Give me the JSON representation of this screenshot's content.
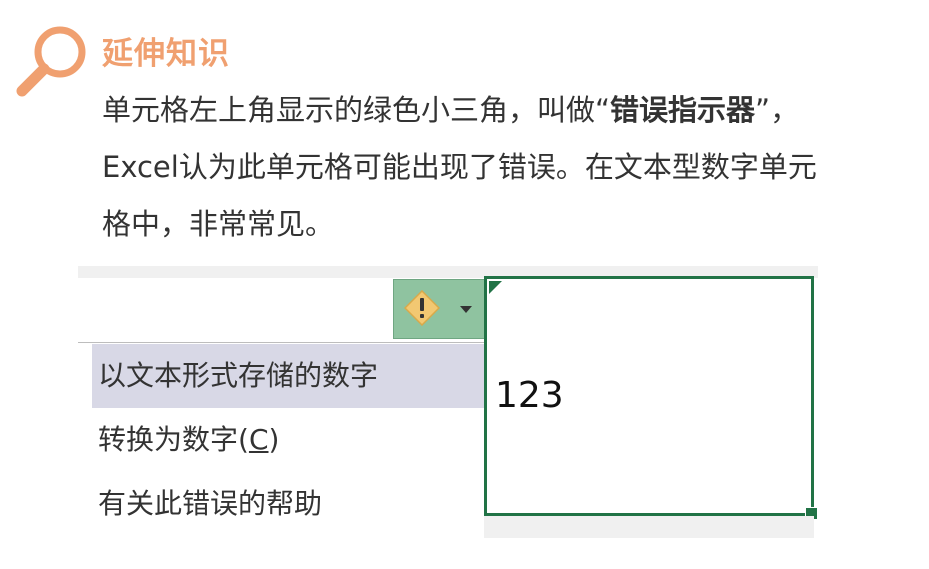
{
  "section": {
    "title": "延伸知识",
    "icon": "magnifier-icon",
    "accent_color": "#f0a070"
  },
  "paragraph": {
    "line1_before": "单元格左上角显示的绿色小三角，叫做“",
    "line1_bold": "错误指示器",
    "line1_after": "”，",
    "line2": "Excel认为此单元格可能出现了错误。在文本型数字单元",
    "line3": "格中，非常常见。"
  },
  "excel": {
    "smart_tag_icon": "warning-diamond-icon",
    "smart_tag_color": "#8fc3a0",
    "menu_items": [
      {
        "label": "以文本形式存储的数字",
        "selected": true
      },
      {
        "label_before": "转换为数字(",
        "label_accel": "C",
        "label_after": ")"
      },
      {
        "label": "有关此错误的帮助"
      }
    ],
    "cell_value": "123",
    "cell_border_color": "#217346"
  }
}
